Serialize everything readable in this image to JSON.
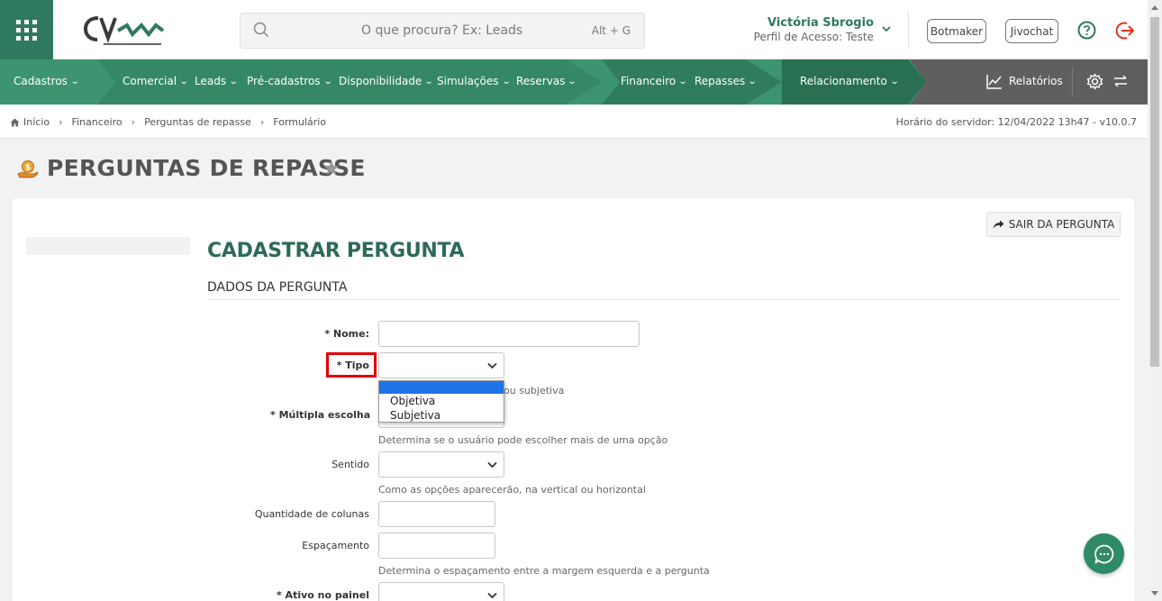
{
  "header": {
    "search_placeholder": "O que procura? Ex: Leads",
    "search_shortcut": "Alt + G",
    "user_name": "Victória Sbrogio",
    "user_role": "Perfil de Acesso: Teste",
    "botmaker_label": "Botmaker",
    "jivochat_label": "Jivochat"
  },
  "nav": {
    "items": [
      {
        "label": "Cadastros"
      },
      {
        "label": "Comercial"
      },
      {
        "label": "Leads"
      },
      {
        "label": "Pré-cadastros"
      },
      {
        "label": "Disponibilidade"
      },
      {
        "label": "Simulações"
      },
      {
        "label": "Reservas"
      },
      {
        "label": "Financeiro"
      },
      {
        "label": "Repasses"
      },
      {
        "label": "Relacionamento"
      }
    ],
    "reports_label": "Relatórios"
  },
  "breadcrumb": {
    "items": [
      "Início",
      "Financeiro",
      "Perguntas de repasse",
      "Formulário"
    ],
    "server_time": "Horário do servidor: 12/04/2022 13h47 - v10.0.7"
  },
  "page": {
    "title": "PERGUNTAS DE REPASSE",
    "exit_button": "SAIR DA PERGUNTA",
    "form_title": "CADASTRAR PERGUNTA",
    "section_title": "DADOS DA PERGUNTA"
  },
  "form": {
    "nome_label": "* Nome:",
    "tipo_label": "* Tipo",
    "tipo_hint_partial": "ou subjetiva",
    "tipo_options": [
      "Objetiva",
      "Subjetiva"
    ],
    "multipla_label": "* Múltipla escolha",
    "multipla_hint": "Determina se o usuário pode escolher mais de uma opção",
    "sentido_label": "Sentido",
    "sentido_hint": "Como as opções aparecerão, na vertical ou horizontal",
    "colunas_label": "Quantidade de colunas",
    "espacamento_label": "Espaçamento",
    "espacamento_hint": "Determina o espaçamento entre a margem esquerda e a pergunta",
    "ativo_label": "* Ativo no painel"
  },
  "colors": {
    "brand_green": "#3c9470",
    "title_green": "#2d6a58",
    "highlight_red": "#e00000",
    "dropdown_selected": "#1e73e8"
  }
}
